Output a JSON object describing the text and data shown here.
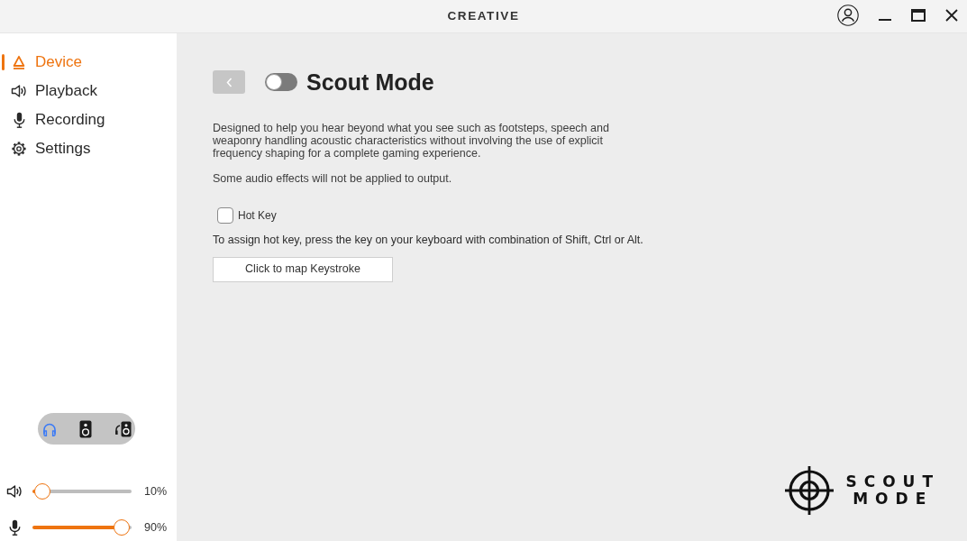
{
  "window": {
    "brand": "CREATIVE"
  },
  "sidebar": {
    "nav": [
      {
        "label": "Device",
        "selected": true
      },
      {
        "label": "Playback",
        "selected": false
      },
      {
        "label": "Recording",
        "selected": false
      },
      {
        "label": "Settings",
        "selected": false
      }
    ],
    "outputs": [
      {
        "selected": true
      },
      {
        "selected": false
      },
      {
        "selected": false
      }
    ],
    "sliders": [
      {
        "level": 0.1,
        "reading": "10%"
      },
      {
        "level": 0.9,
        "reading": "90%"
      }
    ]
  },
  "main": {
    "title": "Scout Mode",
    "toggle": {
      "on": false
    },
    "description": [
      "Designed to help you hear beyond what you see such as footsteps, speech and weaponry handling acoustic characteristics without involving the use of explicit frequency shaping for a complete gaming experience.",
      "Some audio effects will not be applied to output."
    ],
    "hotkey": {
      "label": "Hot Key",
      "checked": false
    },
    "instruction": "To assign hot key, press the key on your keyboard with combination of Shift, Ctrl or Alt.",
    "button": "Click to map Keystroke",
    "logo": [
      "SCOUT",
      "MODE"
    ]
  }
}
